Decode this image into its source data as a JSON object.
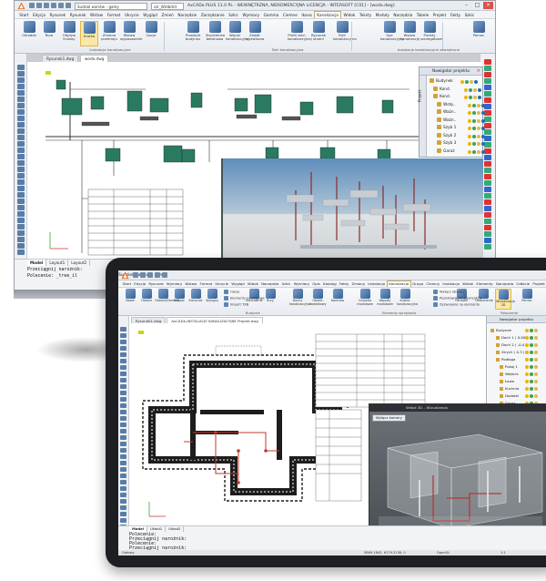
{
  "back_window": {
    "title": "AxCADa PLUS 11.0 PL - WEWNĘTRZNA, NIEKOMERCYJNA LICENCJA - INTERSOFT [C01] - [woda.dwg]",
    "layer_combo": "Sudziel warstw – gamy",
    "style_combo": "szr_Wrdbdrd",
    "menu": [
      "Start",
      "Edycja",
      "Rysunek",
      "Rysunek",
      "Wstaw",
      "Format",
      "Ukrycie",
      "Wygląd",
      "Zmień",
      "Narzędzie",
      "Zarządzanie",
      "Szkic",
      "Wymiary",
      "Gamma",
      "Ciemne",
      "Ikona",
      "Widok",
      "Teksty",
      "Moduły",
      "Narzędzia",
      "Tabele",
      "Projekt",
      "Fakty",
      "Szkic"
    ],
    "active_menu": "Kanalizacja",
    "ribbon_buttons": [
      {
        "label": "Ośrodek"
      },
      {
        "label": "Rura"
      },
      {
        "label": "Odpływ liniowy"
      },
      {
        "label": "Kratka"
      },
      {
        "label": "Zmiana przekroju"
      },
      {
        "label": "Wstaw wyposażenie"
      },
      {
        "label": "Opcje"
      },
      {
        "label": "Przejście budynku"
      },
      {
        "label": "Studzienka betonowa"
      },
      {
        "label": "Wpust kanalizacyjny"
      },
      {
        "label": "Zawór wyzwlacza"
      },
      {
        "label": "Profil sieci kanalizacyjnej"
      },
      {
        "label": "Rysunek studni"
      },
      {
        "label": "Sieć kanalizacyjna"
      },
      {
        "label": "Gaz kanalizacyjny"
      },
      {
        "label": "Wstaw kanalizację"
      },
      {
        "label": "Punkty szczegółowe"
      },
      {
        "label": "Pomoc"
      }
    ],
    "ribbon_groups": [
      "Instalacje kanalizacyjne",
      "Sieć kanalizacyjna",
      "Instalacje kanalizacyjne zewnętrzne"
    ],
    "doc_tabs": [
      "Rysunek1.dwg",
      "woda.dwg"
    ],
    "project_panel": {
      "title": "Nawigator projektu",
      "side_label": "Projekt",
      "items": [
        "Budynek",
        "Kond.",
        "Kond.",
        "Wstę..",
        "Ważn..",
        "Ważn..",
        "Szyb 1",
        "Szyb 2",
        "Szyb 3",
        "Garaż"
      ]
    },
    "layout_tabs": [
      "Model",
      "Layout1",
      "Layout2"
    ],
    "command_lines": [
      "Przeciągnij narożnik:",
      "Polecenie: _tree_il"
    ]
  },
  "front_window": {
    "title": "AxCADa PLUS 11.0 PL - WEWNĘTRZNA, NIEKOMERCYJNA LICENCJA - INTERSOFT [0.1] - [AxCADa INSTALACJE KANALIZACYJNE Projekt]",
    "layer_combo": "Sudziel warstw – gamy",
    "style_combo": "szr_Wrdbdrd",
    "menu": [
      "Start",
      "Edycja",
      "Rysunek",
      "Wymiary",
      "Wstaw",
      "Format",
      "Ukrycie",
      "Wygląd",
      "Widok",
      "Narzędzie",
      "Szkic",
      "Wymiary",
      "Opis",
      "Katalog",
      "Fakty",
      "Zmiany",
      "Instalacja",
      "Grupa",
      "Ciemny",
      "Instalacja",
      "Widok",
      "Elementy",
      "Narzędzia",
      "Odbicie",
      "Projekt"
    ],
    "active_menu": "Kanalizacja",
    "ribbon_buttons": [
      {
        "label": "Nowe"
      },
      {
        "label": "Otwórz"
      },
      {
        "label": "Otwórz/Zamknij"
      },
      {
        "label": "Wstaw"
      },
      {
        "label": "Kierunek"
      },
      {
        "label": "Wyloguj"
      },
      {
        "label": "Szkicownik"
      },
      {
        "label": "Rury"
      },
      {
        "label": "Dachy kanalizacyjne"
      },
      {
        "label": "Obiekt dodatkowy"
      },
      {
        "label": "Kontrola"
      },
      {
        "label": "Gniazdo modułowe"
      },
      {
        "label": "Wpusty modułowe"
      },
      {
        "label": "Kratka kanalizacyjna"
      },
      {
        "label": "Ośrodek"
      },
      {
        "label": "Oświetlenie"
      },
      {
        "label": "Wizualizacja 3D"
      },
      {
        "label": "Pomoc"
      }
    ],
    "small_buttons": [
      "Opcje",
      "Elementy podłogowe",
      "Import TXB",
      "Wyłącz obszary",
      "Pozostawienie elementów",
      "Zezwalanie na elementy"
    ],
    "ribbon_groups": [
      "Budynek",
      "Elementy sprzężenia",
      "Połączenie"
    ],
    "doc_tabs": [
      "Rysunek1.dwg",
      "AxCADa-INSTALACJE KANALIZACYJNE Projekt.dwg"
    ],
    "project_panel": {
      "title": "Nawigator projektu",
      "items": [
        "Budynek",
        "Dach 1 ( 0.00 )",
        "Dach 2 ( -0.4 )",
        "Strych ( 0.3 )",
        "Podłoga",
        "Pokoj 1",
        "Wejście",
        "Ławo",
        "Kuchnia",
        "Dodatki",
        "Garaż"
      ]
    },
    "view3d": {
      "header": "Widok 3D – Wizualizacja",
      "button": "Wyłącz kamery"
    },
    "layout_tabs": [
      "Model",
      "Układ1",
      "Układ2"
    ],
    "command_lines": [
      "Polecenie:",
      "Przeciągnij narożnik:",
      "Polecenie:",
      "Przeciągnij narożnik:",
      "Polecenie:"
    ],
    "status": {
      "left": "Gotowy",
      "coords": "5869.1843, 6179.2136, 0",
      "standard": "OpenGL",
      "zoom": "1:1"
    }
  },
  "colors": {
    "accent": "#e0b84e",
    "pipe_green": "#2a7a62",
    "pipe_red": "#c0392b",
    "wall_dark": "#1d1d1d",
    "stroke_back": "#333333"
  },
  "icons": [
    "app-logo-icon",
    "close-icon",
    "minimize-icon",
    "maximize-icon"
  ]
}
